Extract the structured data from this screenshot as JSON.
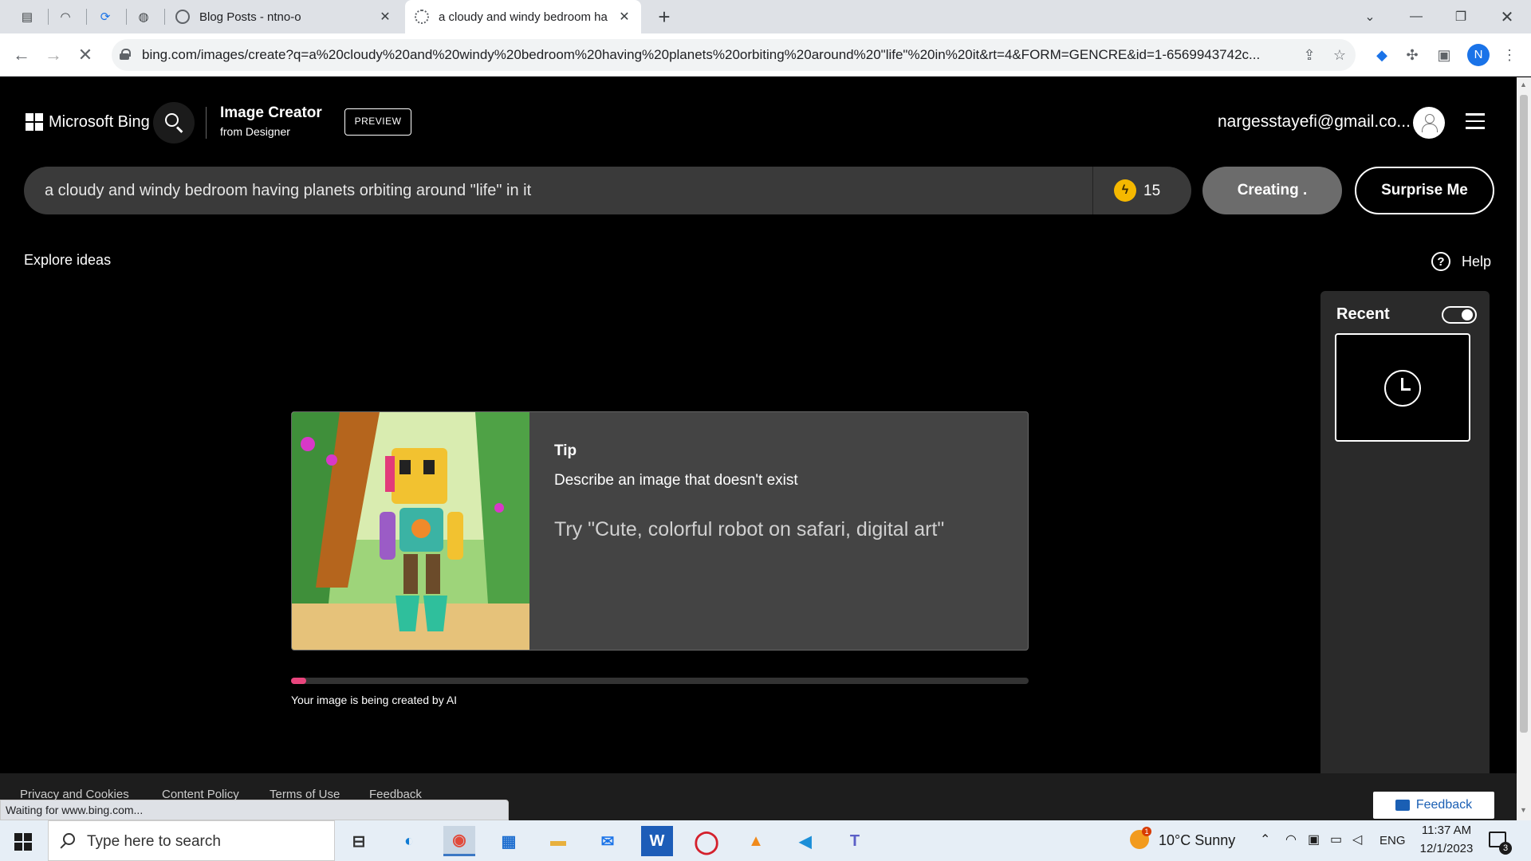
{
  "browser": {
    "tabs": [
      {
        "title": "Blog Posts - ntno-o"
      },
      {
        "title": "a cloudy and windy bedroom ha"
      }
    ],
    "url": "bing.com/images/create?q=a%20cloudy%20and%20windy%20bedroom%20having%20planets%20orbiting%20around%20\"life\"%20in%20it&rt=4&FORM=GENCRE&id=1-6569943742c...",
    "profile_initial": "N",
    "status_text": "Waiting for www.bing.com..."
  },
  "header": {
    "brand": "Microsoft Bing",
    "product_title": "Image Creator",
    "product_sub": "from Designer",
    "preview_badge": "PREVIEW",
    "email": "nargesstayefi@gmail.co..."
  },
  "prompt": {
    "text": "a cloudy and windy bedroom having planets orbiting around \"life\" in it",
    "boost_count": "15",
    "creating_label": "Creating .",
    "surprise_label": "Surprise Me"
  },
  "explore_ideas": "Explore ideas",
  "help_label": "Help",
  "recent": {
    "title": "Recent",
    "toggle_on": true
  },
  "tip": {
    "label": "Tip",
    "heading": "Describe an image that doesn't exist",
    "suggestion": "Try \"Cute, colorful robot on safari, digital art\""
  },
  "progress": {
    "fraction": 0.02,
    "text": "Your image is being created by AI",
    "color": "#e8457d"
  },
  "footer": {
    "links": [
      "Privacy and Cookies",
      "Content Policy",
      "Terms of Use",
      "Feedback"
    ],
    "feedback_button": "Feedback"
  },
  "taskbar": {
    "search_placeholder": "Type here to search",
    "weather": "10°C  Sunny",
    "weather_badge": "1",
    "language": "ENG",
    "time": "11:37 AM",
    "date": "12/1/2023",
    "notification_count": "3",
    "word_icon_letter": "W"
  }
}
